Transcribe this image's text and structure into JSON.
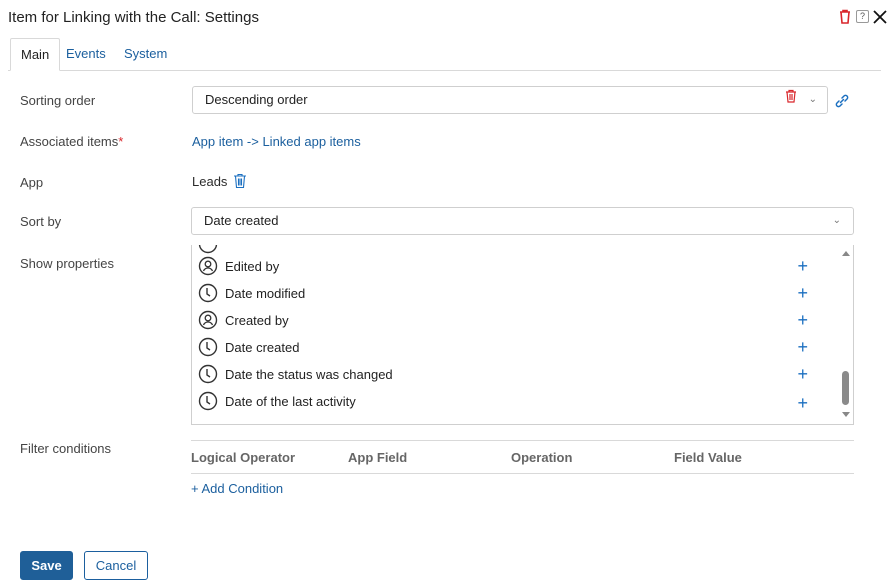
{
  "window": {
    "title": "Item for Linking with the Call: Settings"
  },
  "tabs": [
    {
      "label": "Main",
      "active": true
    },
    {
      "label": "Events",
      "active": false
    },
    {
      "label": "System",
      "active": false
    }
  ],
  "form": {
    "sorting_order": {
      "label": "Sorting order",
      "value": "Descending order"
    },
    "associated_items": {
      "label": "Associated items",
      "required_mark": "*",
      "value": "App item -> Linked app items"
    },
    "app": {
      "label": "App",
      "value": "Leads"
    },
    "sort_by": {
      "label": "Sort by",
      "value": "Date created"
    },
    "show_properties": {
      "label": "Show properties",
      "items": [
        {
          "label": "Edited by",
          "icon": "user-icon"
        },
        {
          "label": "Date modified",
          "icon": "clock-icon"
        },
        {
          "label": "Created by",
          "icon": "user-icon"
        },
        {
          "label": "Date created",
          "icon": "clock-icon"
        },
        {
          "label": "Date the status was changed",
          "icon": "clock-icon"
        },
        {
          "label": "Date of the last activity",
          "icon": "clock-icon"
        }
      ]
    },
    "filter_conditions": {
      "label": "Filter conditions",
      "columns": [
        "Logical Operator",
        "App Field",
        "Operation",
        "Field Value"
      ],
      "add_label": "+ Add Condition"
    }
  },
  "buttons": {
    "save": "Save",
    "cancel": "Cancel"
  },
  "colors": {
    "accent": "#1b5f9e",
    "danger": "#d9262b",
    "primary_button": "#1f5f98"
  }
}
